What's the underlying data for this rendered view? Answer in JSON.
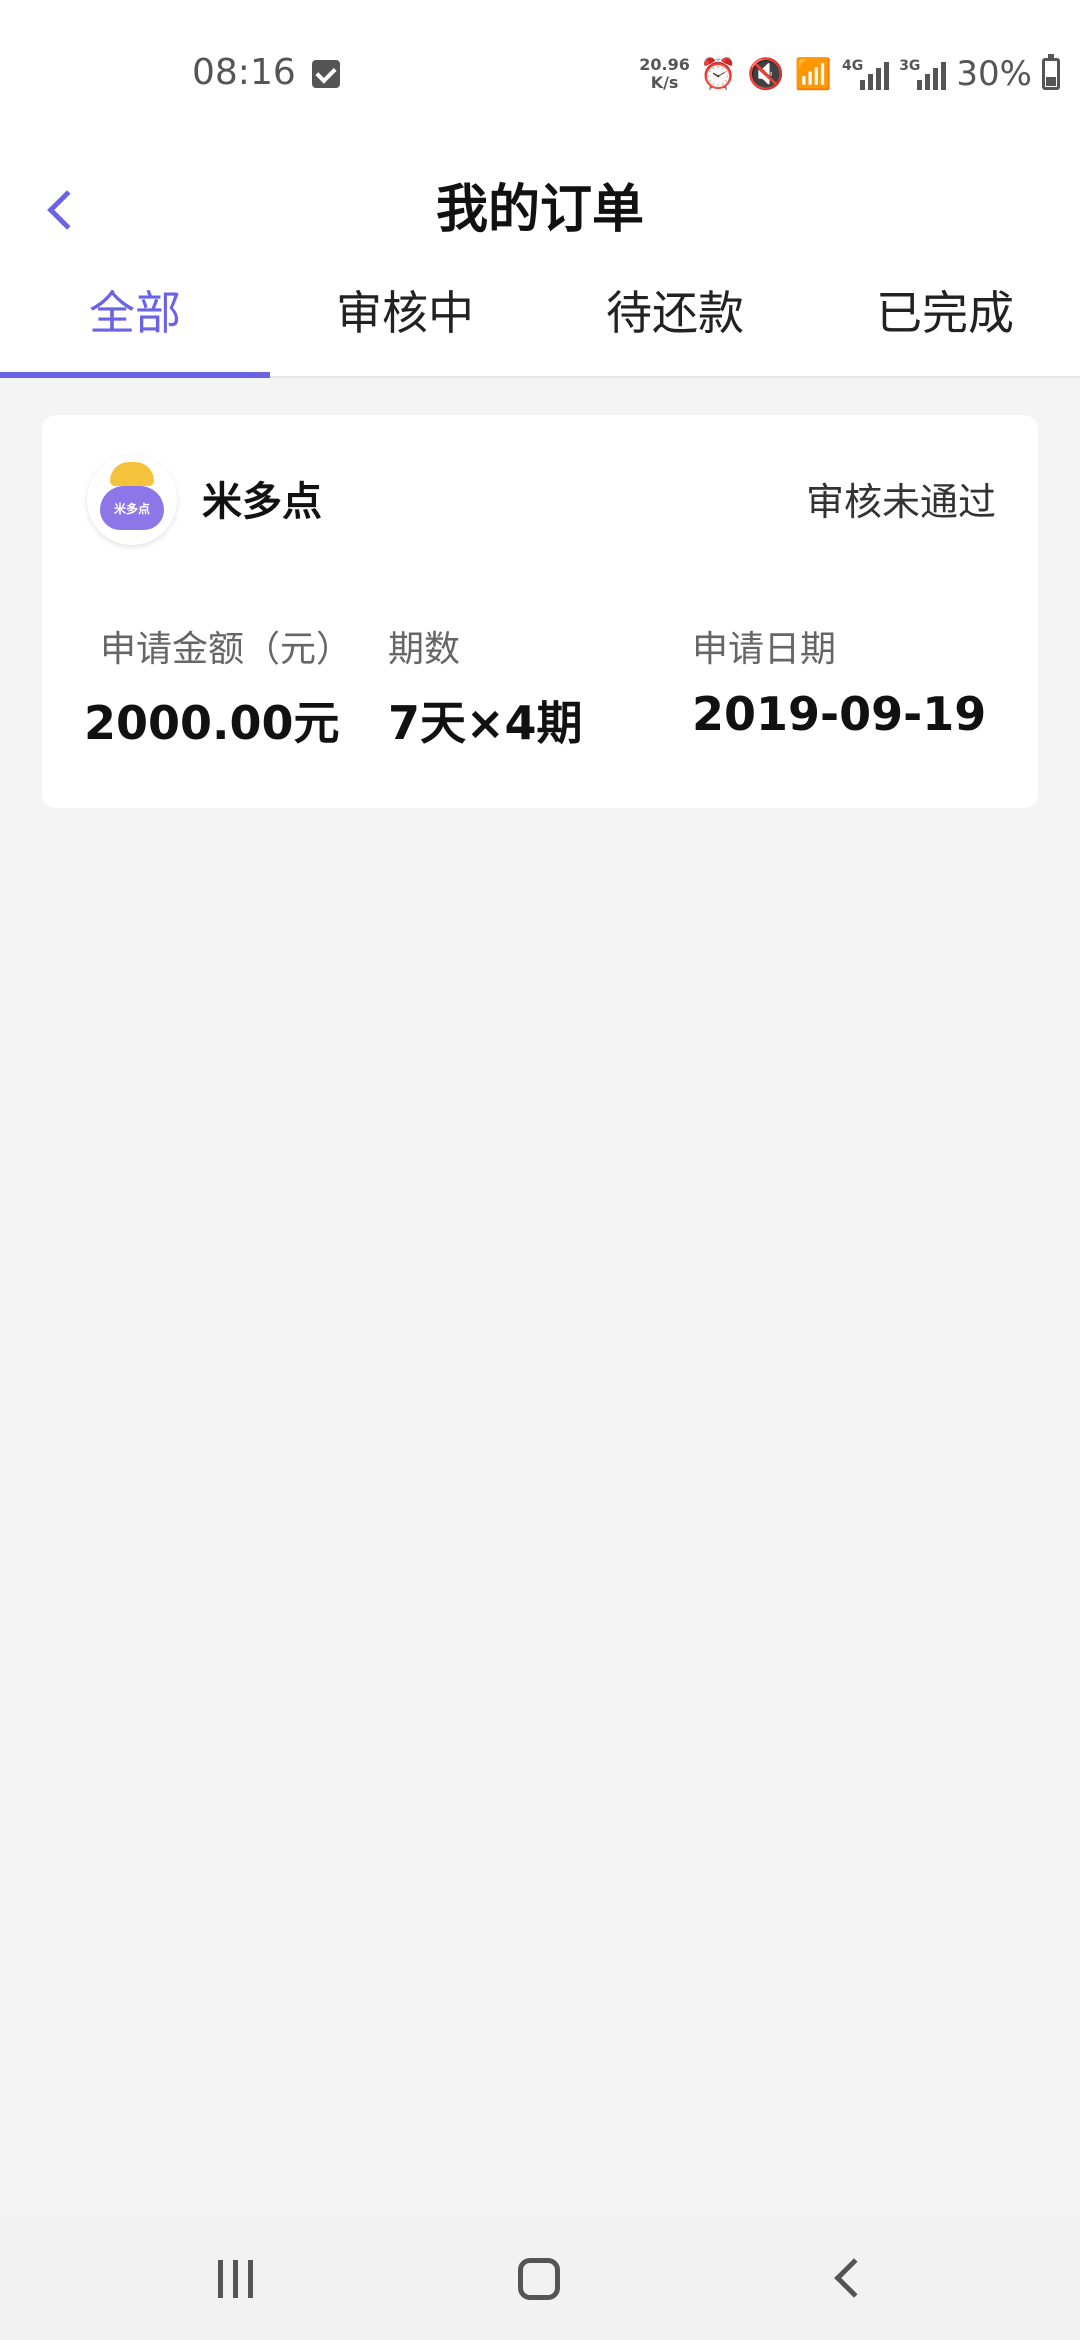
{
  "status_bar": {
    "time": "08:16",
    "net_speed_value": "20.96",
    "net_speed_unit": "K/s",
    "signal1_label": "4G",
    "signal2_label": "3G",
    "battery_percent": "30%"
  },
  "header": {
    "title": "我的订单"
  },
  "tabs": [
    {
      "label": "全部",
      "active": true
    },
    {
      "label": "审核中",
      "active": false
    },
    {
      "label": "待还款",
      "active": false
    },
    {
      "label": "已完成",
      "active": false
    }
  ],
  "orders": [
    {
      "merchant_name": "米多点",
      "logo_text": "米多点",
      "status": "审核未通过",
      "amount_label": "申请金额（元）",
      "amount_value": "2000.00元",
      "period_label": "期数",
      "period_value": "7天×4期",
      "date_label": "申请日期",
      "date_value": "2019-09-19"
    }
  ],
  "colors": {
    "accent": "#6a63e6",
    "background": "#f4f4f4",
    "card": "#ffffff"
  }
}
